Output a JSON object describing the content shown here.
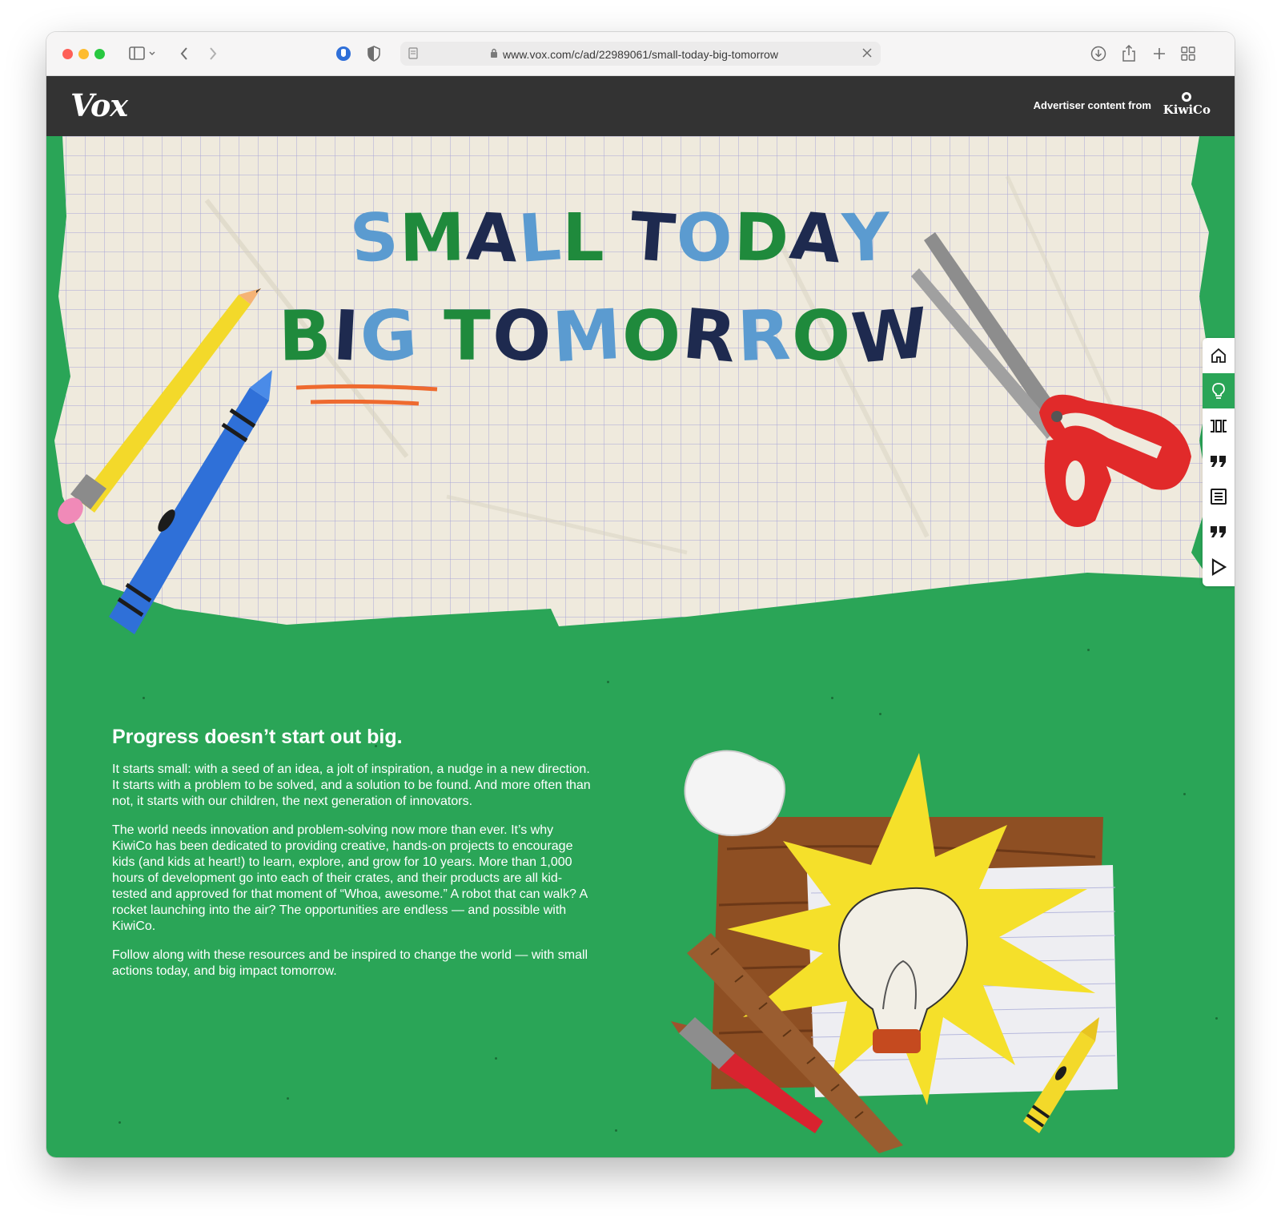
{
  "browser": {
    "url": "www.vox.com/c/ad/22989061/small-today-big-tomorrow"
  },
  "header": {
    "logo": "Vox",
    "advertiser_label": "Advertiser content from",
    "advertiser_name": "KiwiCo"
  },
  "hero": {
    "line1": "SMALL TODAY",
    "line2": "BIG TOMORROW"
  },
  "side_nav": {
    "items": [
      {
        "icon": "home-icon"
      },
      {
        "icon": "lightbulb-icon",
        "active": true
      },
      {
        "icon": "columns-icon"
      },
      {
        "icon": "quote-icon"
      },
      {
        "icon": "article-icon"
      },
      {
        "icon": "quote-icon"
      },
      {
        "icon": "play-icon"
      }
    ]
  },
  "article": {
    "heading": "Progress doesn’t start out big.",
    "paragraphs": [
      "It starts small: with a seed of an idea, a jolt of inspiration, a nudge in a new direction. It starts with a problem to be solved, and a solution to be found. And more often than not, it starts with our children, the next generation of innovators.",
      "The world needs innovation and problem-solving now more than ever. It’s why KiwiCo has been dedicated to providing creative, hands-on projects to encourage kids (and kids at heart!) to learn, explore, and grow for 10 years. More than 1,000 hours of development go into each of their crates, and their products are all kid-tested and approved for that moment of “Whoa, awesome.” A robot that can walk? A rocket launching into the air? The opportunities are endless — and possible with KiwiCo.",
      "Follow along with these resources and be inspired to change the world — with small actions today, and big impact tomorrow."
    ]
  },
  "colors": {
    "green_bg": "#2aa557",
    "header_bg": "#333333",
    "letter_blue": "#5b9bd0",
    "letter_green": "#1f8a3c",
    "letter_navy": "#1e2a4f"
  }
}
